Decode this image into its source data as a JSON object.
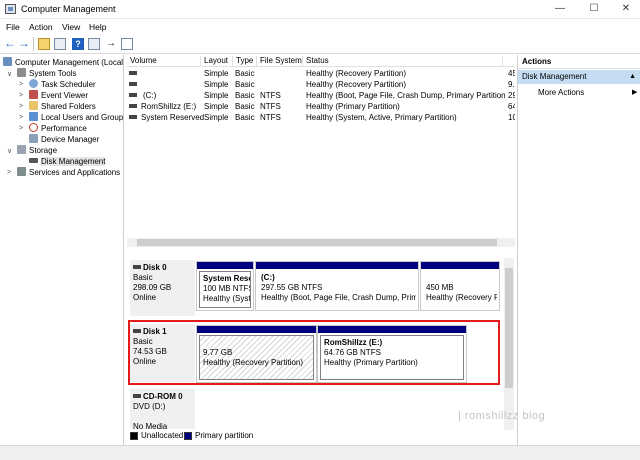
{
  "window": {
    "title": "Computer Management",
    "minimize": "—",
    "maximize": "☐",
    "close": "✕"
  },
  "menu": [
    "File",
    "Action",
    "View",
    "Help"
  ],
  "tree": {
    "root": "Computer Management (Local",
    "system_tools": "System Tools",
    "task_scheduler": "Task Scheduler",
    "event_viewer": "Event Viewer",
    "shared_folders": "Shared Folders",
    "local_users": "Local Users and Groups",
    "performance": "Performance",
    "device_manager": "Device Manager",
    "storage": "Storage",
    "disk_management": "Disk Management",
    "services": "Services and Applications"
  },
  "volume_list": {
    "headers": [
      "Volume",
      "Layout",
      "Type",
      "File System",
      "Status"
    ],
    "rows": [
      {
        "volume": "",
        "layout": "Simple",
        "type": "Basic",
        "fs": "",
        "status": "Healthy (Recovery Partition)",
        "cap": "45"
      },
      {
        "volume": "",
        "layout": "Simple",
        "type": "Basic",
        "fs": "",
        "status": "Healthy (Recovery Partition)",
        "cap": "9."
      },
      {
        "volume": "(C:)",
        "layout": "Simple",
        "type": "Basic",
        "fs": "NTFS",
        "status": "Healthy (Boot, Page File, Crash Dump, Primary Partition)",
        "cap": "29"
      },
      {
        "volume": "RomShillzz (E:)",
        "layout": "Simple",
        "type": "Basic",
        "fs": "NTFS",
        "status": "Healthy (Primary Partition)",
        "cap": "64"
      },
      {
        "volume": "System Reserved",
        "layout": "Simple",
        "type": "Basic",
        "fs": "NTFS",
        "status": "Healthy (System, Active, Primary Partition)",
        "cap": "10"
      }
    ]
  },
  "disks": [
    {
      "name": "Disk 0",
      "type": "Basic",
      "size": "298.09 GB",
      "state": "Online",
      "partitions": [
        {
          "name": "System Reser",
          "size": "100 MB NTFS",
          "status": "Healthy (Syster"
        },
        {
          "name": "(C:)",
          "size": "297.55 GB NTFS",
          "status": "Healthy (Boot, Page File, Crash Dump, Primar"
        },
        {
          "name": "",
          "size": "450 MB",
          "status": "Healthy (Recovery P"
        }
      ]
    },
    {
      "name": "Disk 1",
      "type": "Basic",
      "size": "74.53 GB",
      "state": "Online",
      "partitions": [
        {
          "name": "",
          "size": "9.77 GB",
          "status": "Healthy (Recovery Partition)"
        },
        {
          "name": "RomShillzz  (E:)",
          "size": "64.76 GB NTFS",
          "status": "Healthy (Primary Partition)"
        }
      ]
    },
    {
      "name": "CD-ROM 0",
      "type": "DVD (D:)",
      "size": "",
      "state": "No Media"
    }
  ],
  "legend": {
    "unallocated": "Unallocated",
    "primary": "Primary partition",
    "unallocated_color": "#000000",
    "primary_color": "#00007f"
  },
  "actions": {
    "header": "Actions",
    "section": "Disk Management",
    "more": "More Actions"
  },
  "watermark": "| romshillzz blog",
  "colors": {
    "highlight": "#e21c1c",
    "partition_bar": "#00007f",
    "selection": "#c5dcf3"
  }
}
